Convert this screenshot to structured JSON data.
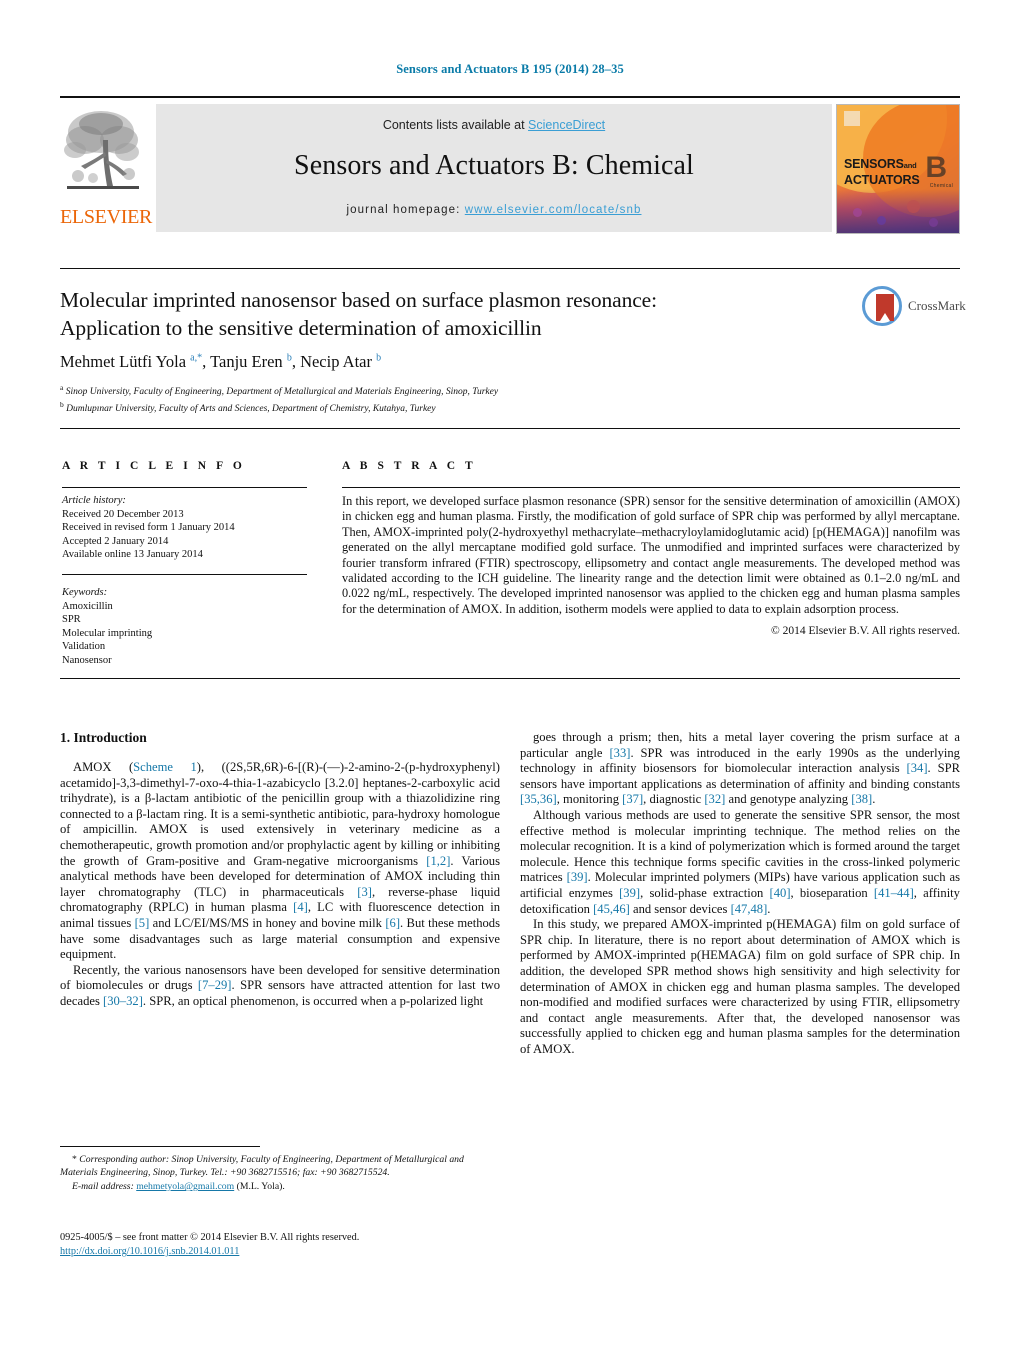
{
  "running_head": "Sensors and Actuators B 195 (2014) 28–35",
  "masthead": {
    "contents_prefix": "Contents lists available at ",
    "contents_link": "ScienceDirect",
    "journal_title": "Sensors and Actuators B: Chemical",
    "homepage_prefix": "journal homepage: ",
    "homepage_url": "www.elsevier.com/locate/snb",
    "publisher_wordmark": "ELSEVIER",
    "cover": {
      "line1": "SENSORS",
      "line1_suffix": "and",
      "line2": "ACTUATORS",
      "volume_letter": "B",
      "volume_sub": "Chemical"
    },
    "colors": {
      "link": "#3a9ed4",
      "band": "#e6e6e6",
      "elsevier_orange": "#eb6608"
    }
  },
  "article": {
    "title": "Molecular imprinted nanosensor based on surface plasmon resonance: Application to the sensitive determination of amoxicillin",
    "crossmark_label": "CrossMark",
    "authors_html": "Mehmet Lütfi Yola <sup>a,*</sup>, Tanju Eren <sup>b</sup>, Necip Atar <sup>b</sup>",
    "affiliations": [
      "a Sinop University, Faculty of Engineering, Department of Metallurgical and Materials Engineering, Sinop, Turkey",
      "b Dumlupınar University, Faculty of Arts and Sciences, Department of Chemistry, Kutahya, Turkey"
    ]
  },
  "article_info": {
    "heading": "A R T I C L E   I N F O",
    "history_label": "Article history:",
    "history": [
      "Received 20 December 2013",
      "Received in revised form 1 January 2014",
      "Accepted 2 January 2014",
      "Available online 13 January 2014"
    ],
    "keywords_label": "Keywords:",
    "keywords": [
      "Amoxicillin",
      "SPR",
      "Molecular imprinting",
      "Validation",
      "Nanosensor"
    ]
  },
  "abstract": {
    "heading": "A B S T R A C T",
    "text": "In this report, we developed surface plasmon resonance (SPR) sensor for the sensitive determination of amoxicillin (AMOX) in chicken egg and human plasma. Firstly, the modification of gold surface of SPR chip was performed by allyl mercaptane. Then, AMOX-imprinted poly(2-hydroxyethyl methacrylate–methacryloylamidoglutamic acid) [p(HEMAGA)] nanofilm was generated on the allyl mercaptane modified gold surface. The unmodified and imprinted surfaces were characterized by fourier transform infrared (FTIR) spectroscopy, ellipsometry and contact angle measurements. The developed method was validated according to the ICH guideline. The linearity range and the detection limit were obtained as 0.1–2.0 ng/mL and 0.022 ng/mL, respectively. The developed imprinted nanosensor was applied to the chicken egg and human plasma samples for the determination of AMOX. In addition, isotherm models were applied to data to explain adsorption process.",
    "copyright": "© 2014 Elsevier B.V. All rights reserved."
  },
  "body": {
    "section_heading": "1. Introduction",
    "left_paragraphs": [
      "AMOX (Scheme 1), ((2S,5R,6R)-6-[(R)-(—)-2-amino-2-(p-hydroxyphenyl) acetamido]-3,3-dimethyl-7-oxo-4-thia-1-azabicyclo [3.2.0] heptanes-2-carboxylic acid trihydrate), is a β-lactam antibiotic of the penicillin group with a thiazolidizine ring connected to a β-lactam ring. It is a semi-synthetic antibiotic, para-hydroxy homologue of ampicillin. AMOX is used extensively in veterinary medicine as a chemotherapeutic, growth promotion and/or prophylactic agent by killing or inhibiting the growth of Gram-positive and Gram-negative microorganisms [1,2]. Various analytical methods have been developed for determination of AMOX including thin layer chromatography (TLC) in pharmaceuticals [3], reverse-phase liquid chromatography (RPLC) in human plasma [4], LC with fluorescence detection in animal tissues [5] and LC/EI/MS/MS in honey and bovine milk [6]. But these methods have some disadvantages such as large material consumption and expensive equipment.",
      "Recently, the various nanosensors have been developed for sensitive determination of biomolecules or drugs [7–29]. SPR sensors have attracted attention for last two decades [30–32]. SPR, an optical phenomenon, is occurred when a p-polarized light"
    ],
    "right_paragraphs": [
      "goes through a prism; then, hits a metal layer covering the prism surface at a particular angle [33]. SPR was introduced in the early 1990s as the underlying technology in affinity biosensors for biomolecular interaction analysis [34]. SPR sensors have important applications as determination of affinity and binding constants [35,36], monitoring [37], diagnostic [32] and genotype analyzing [38].",
      "Although various methods are used to generate the sensitive SPR sensor, the most effective method is molecular imprinting technique. The method relies on the molecular recognition. It is a kind of polymerization which is formed around the target molecule. Hence this technique forms specific cavities in the cross-linked polymeric matrices [39]. Molecular imprinted polymers (MIPs) have various application such as artificial enzymes [39], solid-phase extraction [40], bioseparation [41–44], affinity detoxification [45,46] and sensor devices [47,48].",
      "In this study, we prepared AMOX-imprinted p(HEMAGA) film on gold surface of SPR chip. In literature, there is no report about determination of AMOX which is performed by AMOX-imprinted p(HEMAGA) film on gold surface of SPR chip. In addition, the developed SPR method shows high sensitivity and high selectivity for determination of AMOX in chicken egg and human plasma samples. The developed non-modified and modified surfaces were characterized by using FTIR, ellipsometry and contact angle measurements. After that, the developed nanosensor was successfully applied to chicken egg and human plasma samples for the determination of AMOX."
    ]
  },
  "footer": {
    "corresponding_marker": "*",
    "corresponding_label": "Corresponding author:",
    "corresponding_text": "Sinop University, Faculty of Engineering, Department of Metallurgical and Materials Engineering, Sinop, Turkey. Tel.: +90 3682715516; fax: +90 3682715524.",
    "email_label": "E-mail address:",
    "email": "mehmetyola@gmail.com",
    "email_owner": "(M.L. Yola).",
    "issn_line": "0925-4005/$ – see front matter © 2014 Elsevier B.V. All rights reserved.",
    "doi": "http://dx.doi.org/10.1016/j.snb.2014.01.011"
  }
}
